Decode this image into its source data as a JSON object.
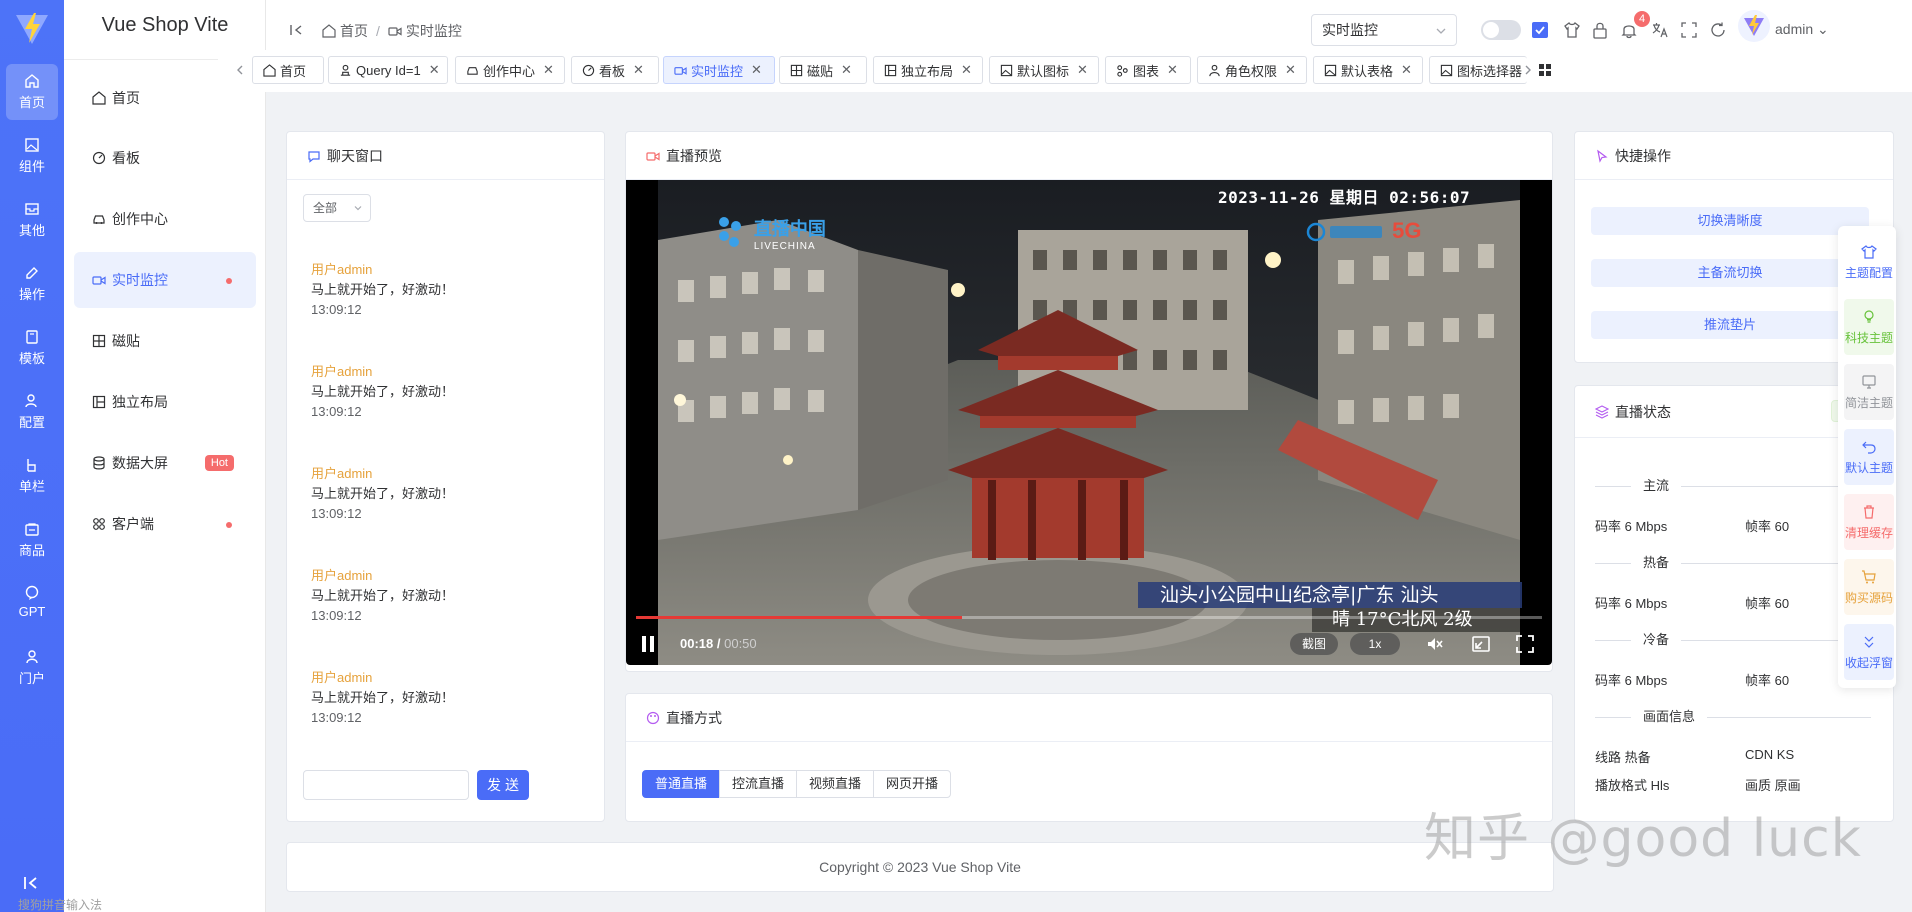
{
  "app": {
    "title": "Vue Shop Vite"
  },
  "colors": {
    "primary": "#4a6cf7",
    "danger": "#f56c6c",
    "warning": "#e6a23c",
    "success": "#67c23a",
    "info": "#909399"
  },
  "rail": {
    "items": [
      {
        "label": "首页",
        "icon": "home-icon"
      },
      {
        "label": "组件",
        "icon": "image-icon"
      },
      {
        "label": "其他",
        "icon": "tray-icon"
      },
      {
        "label": "操作",
        "icon": "pen-icon"
      },
      {
        "label": "模板",
        "icon": "box-icon"
      },
      {
        "label": "配置",
        "icon": "user-settings-icon"
      },
      {
        "label": "单栏",
        "icon": "single-column-icon"
      },
      {
        "label": "商品",
        "icon": "shop-icon"
      },
      {
        "label": "GPT",
        "icon": "chat-bubble-icon"
      },
      {
        "label": "门户",
        "icon": "person-icon"
      }
    ]
  },
  "sidebar": {
    "items": [
      {
        "label": "首页",
        "icon": "home-icon"
      },
      {
        "label": "看板",
        "icon": "dashboard-icon"
      },
      {
        "label": "创作中心",
        "icon": "car-icon"
      },
      {
        "label": "实时监控",
        "icon": "video-camera-icon"
      },
      {
        "label": "磁贴",
        "icon": "tiles-icon"
      },
      {
        "label": "独立布局",
        "icon": "layout-icon"
      },
      {
        "label": "数据大屏",
        "icon": "database-icon",
        "badge": "Hot"
      },
      {
        "label": "客户端",
        "icon": "apps-icon"
      }
    ]
  },
  "header": {
    "breadcrumb": [
      {
        "label": "首页"
      },
      {
        "label": "实时监控"
      }
    ],
    "search_select": "实时监控",
    "notification_count": "4",
    "user": "admin"
  },
  "tabs": [
    {
      "label": "首页"
    },
    {
      "label": "Query Id=1"
    },
    {
      "label": "创作中心"
    },
    {
      "label": "看板"
    },
    {
      "label": "实时监控"
    },
    {
      "label": "磁贴"
    },
    {
      "label": "独立布局"
    },
    {
      "label": "默认图标"
    },
    {
      "label": "图表"
    },
    {
      "label": "角色权限"
    },
    {
      "label": "默认表格"
    },
    {
      "label": "图标选择器"
    }
  ],
  "chat": {
    "title": "聊天窗口",
    "filter": "全部",
    "messages": [
      {
        "user": "用户admin",
        "text": "马上就开始了，好激动！",
        "time": "13:09:12"
      },
      {
        "user": "用户admin",
        "text": "马上就开始了，好激动！",
        "time": "13:09:12"
      },
      {
        "user": "用户admin",
        "text": "马上就开始了，好激动！",
        "time": "13:09:12"
      },
      {
        "user": "用户admin",
        "text": "马上就开始了，好激动！",
        "time": "13:09:12"
      },
      {
        "user": "用户admin",
        "text": "马上就开始了，好激动！",
        "time": "13:09:12"
      }
    ],
    "send_label": "发送"
  },
  "preview": {
    "title": "直播预览",
    "osd_time": "2023-11-26  星期日  02:56:07",
    "channel_logo": "直播中国",
    "channel_logo_en": "LIVECHINA",
    "carrier_5g": "5G",
    "caption_location": "汕头小公园中山纪念亭|广东 汕头",
    "caption_weather": "晴 17°C北风 2级",
    "current_time": "00:18",
    "duration": "00:50",
    "progress": 0.36,
    "screenshot_label": "截图",
    "speed_label": "1x"
  },
  "live_mode": {
    "title": "直播方式",
    "options": [
      {
        "label": "普通直播"
      },
      {
        "label": "控流直播"
      },
      {
        "label": "视频直播"
      },
      {
        "label": "网页开播"
      }
    ],
    "selected": "普通直播"
  },
  "quick_ops": {
    "title": "快捷操作",
    "buttons": [
      {
        "label": "切换清晰度"
      },
      {
        "label": "主备流切换"
      },
      {
        "label": "推流垫片"
      }
    ]
  },
  "live_status": {
    "title": "直播状态",
    "sections": [
      {
        "name": "主流",
        "bitrate": "码率 6 Mbps",
        "fps": "帧率 60"
      },
      {
        "name": "热备",
        "bitrate": "码率 6 Mbps",
        "fps": "帧率 60"
      },
      {
        "name": "冷备",
        "bitrate": "码率 6 Mbps",
        "fps": "帧率 60"
      }
    ],
    "picture_info_title": "画面信息",
    "route": "线路 热备",
    "cdn": "CDN KS",
    "format": "播放格式 Hls",
    "quality": "画质 原画"
  },
  "float_panel": {
    "items": [
      {
        "label": "主题配置",
        "color": "#4a6cf7",
        "icon": "shirt-icon"
      },
      {
        "label": "科技主题",
        "color": "#67c23a",
        "icon": "bulb-icon"
      },
      {
        "label": "简洁主题",
        "color": "#909399",
        "icon": "monitor-icon"
      },
      {
        "label": "默认主题",
        "color": "#4a6cf7",
        "icon": "undo-icon"
      },
      {
        "label": "清理缓存",
        "color": "#f56c6c",
        "icon": "trash-icon"
      },
      {
        "label": "购买源码",
        "color": "#e6a23c",
        "icon": "cart-icon"
      },
      {
        "label": "收起浮窗",
        "color": "#4a6cf7",
        "icon": "collapse-icon"
      }
    ]
  },
  "footer": {
    "copyright": "Copyright © 2023 Vue Shop Vite"
  },
  "watermark": "知乎 @good luck",
  "ime_hint": "搜狗拼音输入法"
}
